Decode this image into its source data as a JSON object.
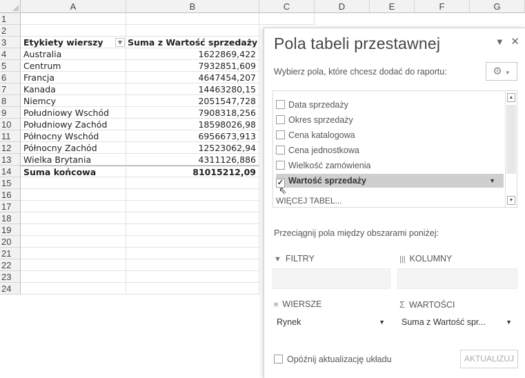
{
  "grid": {
    "columns": [
      "A",
      "B",
      "C",
      "D",
      "E",
      "F",
      "G"
    ],
    "rows": [
      "1",
      "2",
      "3",
      "4",
      "5",
      "6",
      "7",
      "8",
      "9",
      "10",
      "11",
      "12",
      "13",
      "14",
      "15",
      "16",
      "17",
      "18",
      "19",
      "20",
      "21",
      "22",
      "23",
      "24"
    ]
  },
  "pivot": {
    "row_header": "Etykiety wierszy",
    "value_header": "Suma z Wartość sprzedaży",
    "rows": [
      {
        "label": "Australia",
        "value": "1622869,422"
      },
      {
        "label": "Centrum",
        "value": "7932851,609"
      },
      {
        "label": "Francja",
        "value": "4647454,207"
      },
      {
        "label": "Kanada",
        "value": "14463280,15"
      },
      {
        "label": "Niemcy",
        "value": "2051547,728"
      },
      {
        "label": "Południowy Wschód",
        "value": "7908318,256"
      },
      {
        "label": "Południowy Zachód",
        "value": "18598026,98"
      },
      {
        "label": "Północny Wschód",
        "value": "6956673,913"
      },
      {
        "label": "Północny Zachód",
        "value": "12523062,94"
      },
      {
        "label": "Wielka Brytania",
        "value": "4311126,886"
      }
    ],
    "total_label": "Suma końcowa",
    "total_value": "81015212,09"
  },
  "panel": {
    "title": "Pola tabeli przestawnej",
    "prompt": "Wybierz pola, które chcesz dodać do raportu:",
    "fields": [
      {
        "label": "Data sprzedaży",
        "checked": false
      },
      {
        "label": "Okres sprzedaży",
        "checked": false
      },
      {
        "label": "Cena katalogowa",
        "checked": false
      },
      {
        "label": "Cena jednostkowa",
        "checked": false
      },
      {
        "label": "Wielkość zamówienia",
        "checked": false
      },
      {
        "label": "Wartość sprzedaży",
        "checked": true
      }
    ],
    "more_tables": "WIĘCEJ TABEL...",
    "drag_text": "Przeciągnij pola między obszarami poniżej:",
    "areas": {
      "filters_label": "FILTRY",
      "columns_label": "KOLUMNY",
      "rows_label": "WIERSZE",
      "values_label": "WARTOŚCI",
      "rows_item": "Rynek",
      "values_item": "Suma z Wartość spr..."
    },
    "defer_label": "Opóźnij aktualizację układu",
    "update_label": "AKTUALIZUJ"
  }
}
